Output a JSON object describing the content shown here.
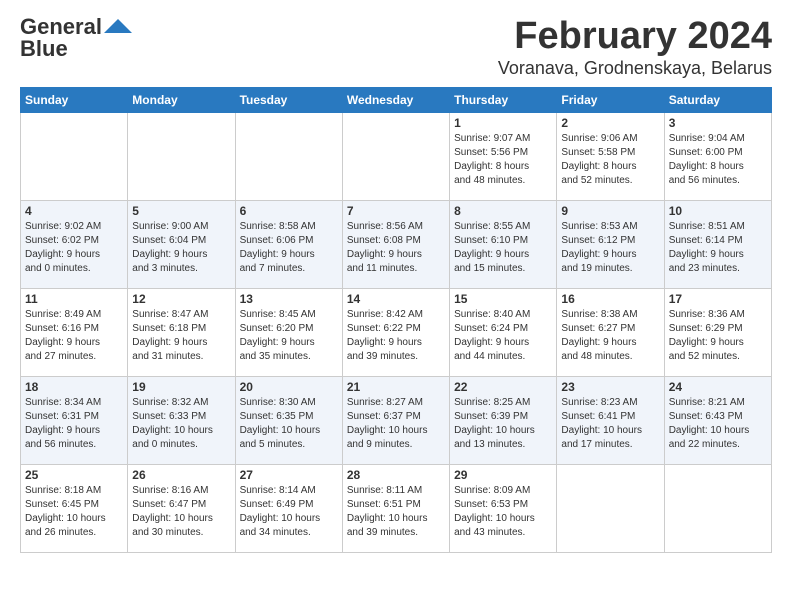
{
  "header": {
    "logo_general": "General",
    "logo_blue": "Blue",
    "month_title": "February 2024",
    "location": "Voranava, Grodnenskaya, Belarus"
  },
  "calendar": {
    "days_of_week": [
      "Sunday",
      "Monday",
      "Tuesday",
      "Wednesday",
      "Thursday",
      "Friday",
      "Saturday"
    ],
    "weeks": [
      [
        {
          "day": "",
          "info": ""
        },
        {
          "day": "",
          "info": ""
        },
        {
          "day": "",
          "info": ""
        },
        {
          "day": "",
          "info": ""
        },
        {
          "day": "1",
          "info": "Sunrise: 9:07 AM\nSunset: 5:56 PM\nDaylight: 8 hours\nand 48 minutes."
        },
        {
          "day": "2",
          "info": "Sunrise: 9:06 AM\nSunset: 5:58 PM\nDaylight: 8 hours\nand 52 minutes."
        },
        {
          "day": "3",
          "info": "Sunrise: 9:04 AM\nSunset: 6:00 PM\nDaylight: 8 hours\nand 56 minutes."
        }
      ],
      [
        {
          "day": "4",
          "info": "Sunrise: 9:02 AM\nSunset: 6:02 PM\nDaylight: 9 hours\nand 0 minutes."
        },
        {
          "day": "5",
          "info": "Sunrise: 9:00 AM\nSunset: 6:04 PM\nDaylight: 9 hours\nand 3 minutes."
        },
        {
          "day": "6",
          "info": "Sunrise: 8:58 AM\nSunset: 6:06 PM\nDaylight: 9 hours\nand 7 minutes."
        },
        {
          "day": "7",
          "info": "Sunrise: 8:56 AM\nSunset: 6:08 PM\nDaylight: 9 hours\nand 11 minutes."
        },
        {
          "day": "8",
          "info": "Sunrise: 8:55 AM\nSunset: 6:10 PM\nDaylight: 9 hours\nand 15 minutes."
        },
        {
          "day": "9",
          "info": "Sunrise: 8:53 AM\nSunset: 6:12 PM\nDaylight: 9 hours\nand 19 minutes."
        },
        {
          "day": "10",
          "info": "Sunrise: 8:51 AM\nSunset: 6:14 PM\nDaylight: 9 hours\nand 23 minutes."
        }
      ],
      [
        {
          "day": "11",
          "info": "Sunrise: 8:49 AM\nSunset: 6:16 PM\nDaylight: 9 hours\nand 27 minutes."
        },
        {
          "day": "12",
          "info": "Sunrise: 8:47 AM\nSunset: 6:18 PM\nDaylight: 9 hours\nand 31 minutes."
        },
        {
          "day": "13",
          "info": "Sunrise: 8:45 AM\nSunset: 6:20 PM\nDaylight: 9 hours\nand 35 minutes."
        },
        {
          "day": "14",
          "info": "Sunrise: 8:42 AM\nSunset: 6:22 PM\nDaylight: 9 hours\nand 39 minutes."
        },
        {
          "day": "15",
          "info": "Sunrise: 8:40 AM\nSunset: 6:24 PM\nDaylight: 9 hours\nand 44 minutes."
        },
        {
          "day": "16",
          "info": "Sunrise: 8:38 AM\nSunset: 6:27 PM\nDaylight: 9 hours\nand 48 minutes."
        },
        {
          "day": "17",
          "info": "Sunrise: 8:36 AM\nSunset: 6:29 PM\nDaylight: 9 hours\nand 52 minutes."
        }
      ],
      [
        {
          "day": "18",
          "info": "Sunrise: 8:34 AM\nSunset: 6:31 PM\nDaylight: 9 hours\nand 56 minutes."
        },
        {
          "day": "19",
          "info": "Sunrise: 8:32 AM\nSunset: 6:33 PM\nDaylight: 10 hours\nand 0 minutes."
        },
        {
          "day": "20",
          "info": "Sunrise: 8:30 AM\nSunset: 6:35 PM\nDaylight: 10 hours\nand 5 minutes."
        },
        {
          "day": "21",
          "info": "Sunrise: 8:27 AM\nSunset: 6:37 PM\nDaylight: 10 hours\nand 9 minutes."
        },
        {
          "day": "22",
          "info": "Sunrise: 8:25 AM\nSunset: 6:39 PM\nDaylight: 10 hours\nand 13 minutes."
        },
        {
          "day": "23",
          "info": "Sunrise: 8:23 AM\nSunset: 6:41 PM\nDaylight: 10 hours\nand 17 minutes."
        },
        {
          "day": "24",
          "info": "Sunrise: 8:21 AM\nSunset: 6:43 PM\nDaylight: 10 hours\nand 22 minutes."
        }
      ],
      [
        {
          "day": "25",
          "info": "Sunrise: 8:18 AM\nSunset: 6:45 PM\nDaylight: 10 hours\nand 26 minutes."
        },
        {
          "day": "26",
          "info": "Sunrise: 8:16 AM\nSunset: 6:47 PM\nDaylight: 10 hours\nand 30 minutes."
        },
        {
          "day": "27",
          "info": "Sunrise: 8:14 AM\nSunset: 6:49 PM\nDaylight: 10 hours\nand 34 minutes."
        },
        {
          "day": "28",
          "info": "Sunrise: 8:11 AM\nSunset: 6:51 PM\nDaylight: 10 hours\nand 39 minutes."
        },
        {
          "day": "29",
          "info": "Sunrise: 8:09 AM\nSunset: 6:53 PM\nDaylight: 10 hours\nand 43 minutes."
        },
        {
          "day": "",
          "info": ""
        },
        {
          "day": "",
          "info": ""
        }
      ]
    ]
  }
}
